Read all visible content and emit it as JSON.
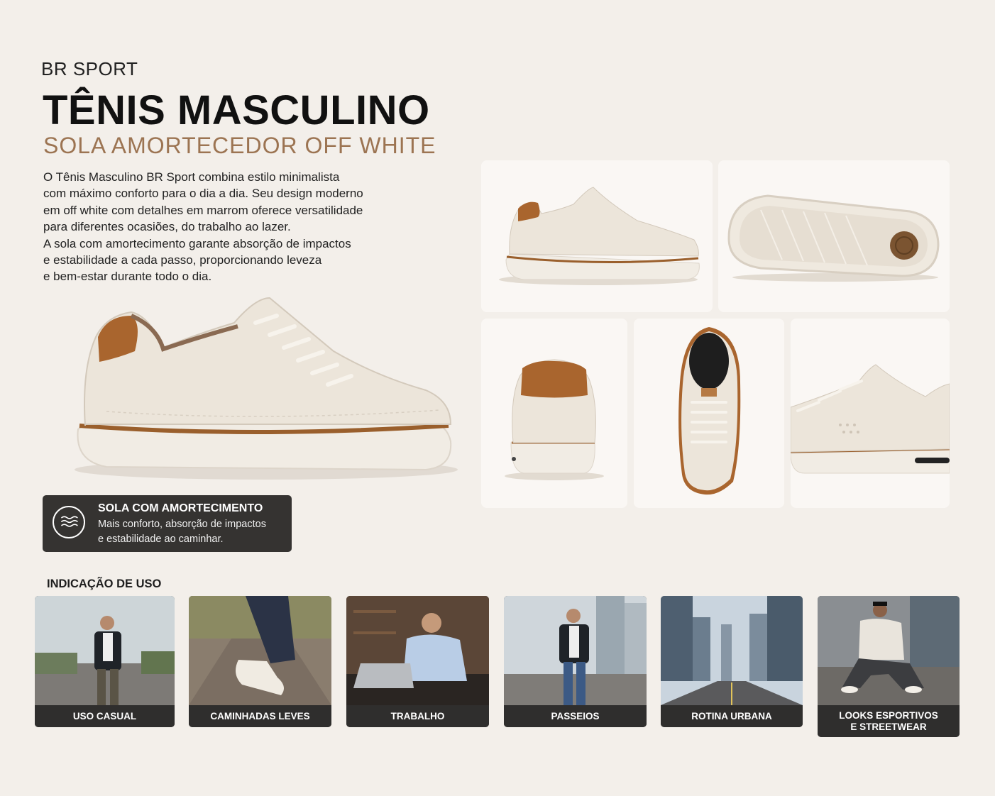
{
  "header": {
    "brand": "BR SPORT",
    "title": "TÊNIS MASCULINO",
    "subtitle": "SOLA AMORTECEDOR OFF WHITE"
  },
  "description": {
    "lines": [
      "O Tênis Masculino BR Sport combina estilo minimalista",
      "com máximo conforto para o dia a dia. Seu design moderno",
      "em off white com detalhes em marrom oferece versatilidade",
      "para diferentes ocasiões, do trabalho ao lazer.",
      "A sola com amortecimento garante absorção de impactos",
      "e estabilidade a cada passo, proporcionando leveza",
      "e bem-estar durante todo o dia."
    ]
  },
  "feature_badge": {
    "icon": "waves-icon",
    "title": "SOLA COM AMORTECIMENTO",
    "text_line1": "Mais conforto, absorção de impactos",
    "text_line2": "e estabilidade ao caminhar."
  },
  "usage": {
    "heading": "INDICAÇÃO DE USO",
    "items": [
      {
        "label": "USO CASUAL"
      },
      {
        "label": "CAMINHADAS LEVES"
      },
      {
        "label": "TRABALHO"
      },
      {
        "label": "PASSEIOS"
      },
      {
        "label": "ROTINA URBANA"
      },
      {
        "label": "LOOKS ESPORTIVOS\nE STREETWEAR"
      }
    ]
  },
  "colors": {
    "background": "#f3efea",
    "accent_brown": "#9c7452",
    "shoe_offwhite": "#ede6dc",
    "badge_dark": "#353331"
  }
}
